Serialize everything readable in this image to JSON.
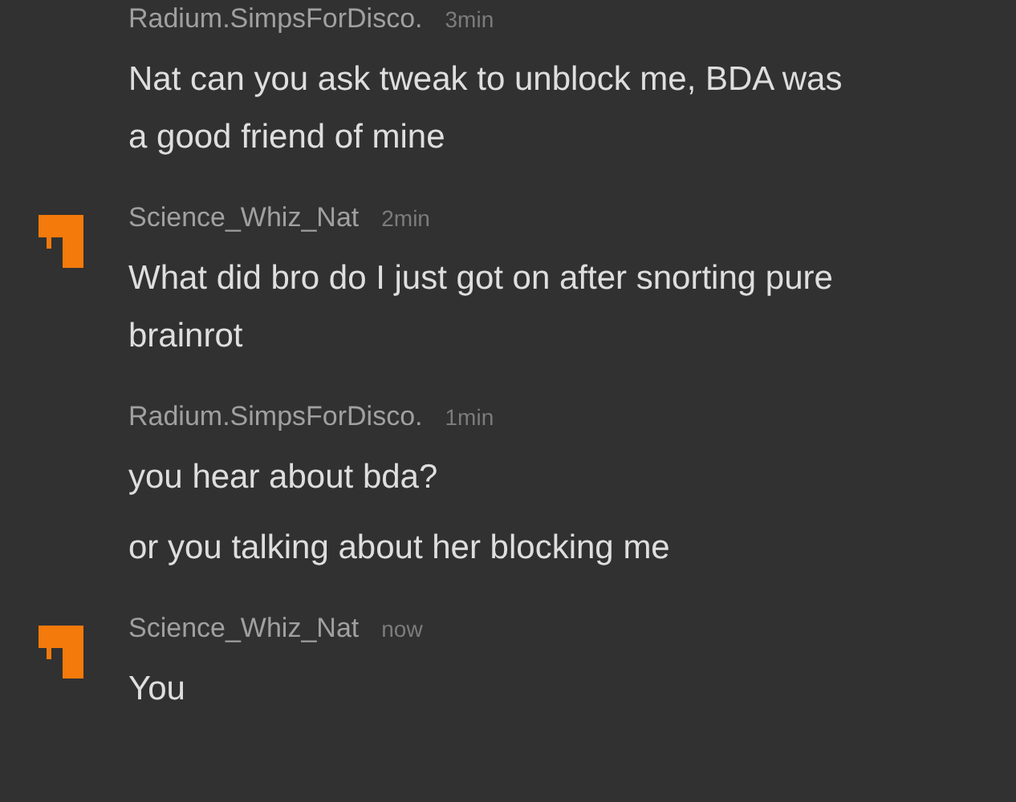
{
  "messages": [
    {
      "author": "Radium.SimpsForDisco.",
      "time": "3min",
      "avatar": false,
      "lines": [
        "Nat can you ask tweak to unblock me, BDA was\na good friend of mine"
      ]
    },
    {
      "author": "Science_Whiz_Nat",
      "time": "2min",
      "avatar": true,
      "lines": [
        "What did bro do I just got on after snorting pure\nbrainrot"
      ]
    },
    {
      "author": "Radium.SimpsForDisco.",
      "time": "1min",
      "avatar": false,
      "lines": [
        "you hear about bda?",
        "or you talking about her blocking me"
      ]
    },
    {
      "author": "Science_Whiz_Nat",
      "time": "now",
      "avatar": true,
      "lines": [
        "You"
      ]
    }
  ]
}
